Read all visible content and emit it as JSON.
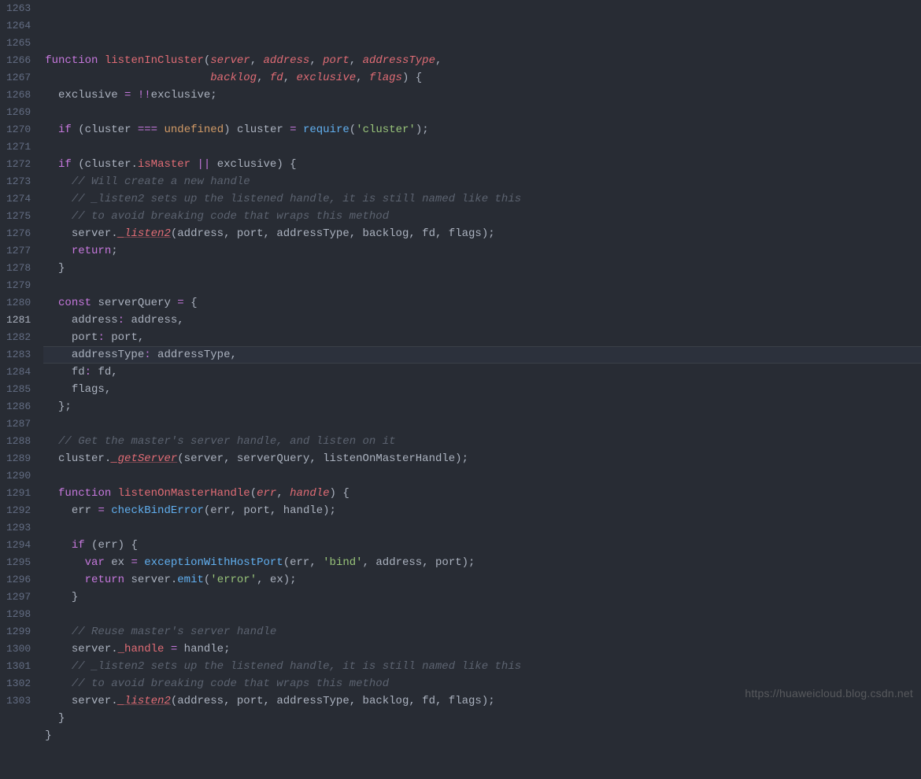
{
  "watermark": "https://huaweicloud.blog.csdn.net",
  "line_start": 1263,
  "line_end": 1303,
  "active_line": 1281,
  "code_lines": {
    "1263": "",
    "1264": "function listenInCluster(server, address, port, addressType,",
    "1265": "                         backlog, fd, exclusive, flags) {",
    "1266": "  exclusive = !!exclusive;",
    "1267": "",
    "1268": "  if (cluster === undefined) cluster = require('cluster');",
    "1269": "",
    "1270": "  if (cluster.isMaster || exclusive) {",
    "1271": "    // Will create a new handle",
    "1272": "    // _listen2 sets up the listened handle, it is still named like this",
    "1273": "    // to avoid breaking code that wraps this method",
    "1274": "    server._listen2(address, port, addressType, backlog, fd, flags);",
    "1275": "    return;",
    "1276": "  }",
    "1277": "",
    "1278": "  const serverQuery = {",
    "1279": "    address: address,",
    "1280": "    port: port,",
    "1281": "    addressType: addressType,",
    "1282": "    fd: fd,",
    "1283": "    flags,",
    "1284": "  };",
    "1285": "",
    "1286": "  // Get the master's server handle, and listen on it",
    "1287": "  cluster._getServer(server, serverQuery, listenOnMasterHandle);",
    "1288": "",
    "1289": "  function listenOnMasterHandle(err, handle) {",
    "1290": "    err = checkBindError(err, port, handle);",
    "1291": "",
    "1292": "    if (err) {",
    "1293": "      var ex = exceptionWithHostPort(err, 'bind', address, port);",
    "1294": "      return server.emit('error', ex);",
    "1295": "    }",
    "1296": "",
    "1297": "    // Reuse master's server handle",
    "1298": "    server._handle = handle;",
    "1299": "    // _listen2 sets up the listened handle, it is still named like this",
    "1300": "    // to avoid breaking code that wraps this method",
    "1301": "    server._listen2(address, port, addressType, backlog, fd, flags);",
    "1302": "  }",
    "1303": "}"
  },
  "tokens": {
    "1264": [
      [
        "kw",
        "function "
      ],
      [
        "decl",
        "listenInCluster"
      ],
      [
        "punc",
        "("
      ],
      [
        "param",
        "server"
      ],
      [
        "punc",
        ", "
      ],
      [
        "param",
        "address"
      ],
      [
        "punc",
        ", "
      ],
      [
        "param",
        "port"
      ],
      [
        "punc",
        ", "
      ],
      [
        "param",
        "addressType"
      ],
      [
        "punc",
        ","
      ]
    ],
    "1265": [
      [
        "ident",
        "                         "
      ],
      [
        "param",
        "backlog"
      ],
      [
        "punc",
        ", "
      ],
      [
        "param",
        "fd"
      ],
      [
        "punc",
        ", "
      ],
      [
        "param",
        "exclusive"
      ],
      [
        "punc",
        ", "
      ],
      [
        "param",
        "flags"
      ],
      [
        "punc",
        ") {"
      ]
    ],
    "1266": [
      [
        "ident",
        "  exclusive "
      ],
      [
        "op",
        "="
      ],
      [
        "ident",
        " "
      ],
      [
        "op",
        "!!"
      ],
      [
        "ident",
        "exclusive"
      ],
      [
        "punc",
        ";"
      ]
    ],
    "1267": [],
    "1268": [
      [
        "ident",
        "  "
      ],
      [
        "kw",
        "if"
      ],
      [
        "punc",
        " ("
      ],
      [
        "ident",
        "cluster "
      ],
      [
        "op",
        "==="
      ],
      [
        "ident",
        " "
      ],
      [
        "const",
        "undefined"
      ],
      [
        "punc",
        ") "
      ],
      [
        "ident",
        "cluster "
      ],
      [
        "op",
        "="
      ],
      [
        "ident",
        " "
      ],
      [
        "fn",
        "require"
      ],
      [
        "punc",
        "("
      ],
      [
        "str",
        "'cluster'"
      ],
      [
        "punc",
        ");"
      ]
    ],
    "1269": [],
    "1270": [
      [
        "ident",
        "  "
      ],
      [
        "kw",
        "if"
      ],
      [
        "punc",
        " ("
      ],
      [
        "ident",
        "cluster"
      ],
      [
        "punc",
        "."
      ],
      [
        "prop",
        "isMaster"
      ],
      [
        "ident",
        " "
      ],
      [
        "op",
        "||"
      ],
      [
        "ident",
        " exclusive"
      ],
      [
        "punc",
        ") {"
      ]
    ],
    "1271": [
      [
        "ident",
        "    "
      ],
      [
        "cm",
        "// Will create a new handle"
      ]
    ],
    "1272": [
      [
        "ident",
        "    "
      ],
      [
        "cm",
        "// _listen2 sets up the listened handle, it is still named like this"
      ]
    ],
    "1273": [
      [
        "ident",
        "    "
      ],
      [
        "cm",
        "// to avoid breaking code that wraps this method"
      ]
    ],
    "1274": [
      [
        "ident",
        "    server"
      ],
      [
        "punc",
        "."
      ],
      [
        "propI",
        "_listen2"
      ],
      [
        "punc",
        "("
      ],
      [
        "ident",
        "address"
      ],
      [
        "punc",
        ", "
      ],
      [
        "ident",
        "port"
      ],
      [
        "punc",
        ", "
      ],
      [
        "ident",
        "addressType"
      ],
      [
        "punc",
        ", "
      ],
      [
        "ident",
        "backlog"
      ],
      [
        "punc",
        ", "
      ],
      [
        "ident",
        "fd"
      ],
      [
        "punc",
        ", "
      ],
      [
        "ident",
        "flags"
      ],
      [
        "punc",
        ");"
      ]
    ],
    "1275": [
      [
        "ident",
        "    "
      ],
      [
        "kw",
        "return"
      ],
      [
        "punc",
        ";"
      ]
    ],
    "1276": [
      [
        "punc",
        "  }"
      ]
    ],
    "1277": [],
    "1278": [
      [
        "ident",
        "  "
      ],
      [
        "kw",
        "const"
      ],
      [
        "ident",
        " serverQuery "
      ],
      [
        "op",
        "="
      ],
      [
        "punc",
        " {"
      ]
    ],
    "1279": [
      [
        "ident",
        "    address"
      ],
      [
        "op",
        ":"
      ],
      [
        "ident",
        " address"
      ],
      [
        "punc",
        ","
      ]
    ],
    "1280": [
      [
        "ident",
        "    port"
      ],
      [
        "op",
        ":"
      ],
      [
        "ident",
        " port"
      ],
      [
        "punc",
        ","
      ]
    ],
    "1281": [
      [
        "ident",
        "    addressType"
      ],
      [
        "op",
        ":"
      ],
      [
        "ident",
        " addressType"
      ],
      [
        "punc",
        ","
      ]
    ],
    "1282": [
      [
        "ident",
        "    fd"
      ],
      [
        "op",
        ":"
      ],
      [
        "ident",
        " fd"
      ],
      [
        "punc",
        ","
      ]
    ],
    "1283": [
      [
        "ident",
        "    flags"
      ],
      [
        "punc",
        ","
      ]
    ],
    "1284": [
      [
        "punc",
        "  };"
      ]
    ],
    "1285": [],
    "1286": [
      [
        "ident",
        "  "
      ],
      [
        "cm",
        "// Get the master's server handle, and listen on it"
      ]
    ],
    "1287": [
      [
        "ident",
        "  cluster"
      ],
      [
        "punc",
        "."
      ],
      [
        "propI",
        "_getServer"
      ],
      [
        "punc",
        "("
      ],
      [
        "ident",
        "server"
      ],
      [
        "punc",
        ", "
      ],
      [
        "ident",
        "serverQuery"
      ],
      [
        "punc",
        ", "
      ],
      [
        "ident",
        "listenOnMasterHandle"
      ],
      [
        "punc",
        ");"
      ]
    ],
    "1288": [],
    "1289": [
      [
        "ident",
        "  "
      ],
      [
        "kw",
        "function "
      ],
      [
        "decl",
        "listenOnMasterHandle"
      ],
      [
        "punc",
        "("
      ],
      [
        "param",
        "err"
      ],
      [
        "punc",
        ", "
      ],
      [
        "param",
        "handle"
      ],
      [
        "punc",
        ") {"
      ]
    ],
    "1290": [
      [
        "ident",
        "    err "
      ],
      [
        "op",
        "="
      ],
      [
        "ident",
        " "
      ],
      [
        "fn",
        "checkBindError"
      ],
      [
        "punc",
        "("
      ],
      [
        "ident",
        "err"
      ],
      [
        "punc",
        ", "
      ],
      [
        "ident",
        "port"
      ],
      [
        "punc",
        ", "
      ],
      [
        "ident",
        "handle"
      ],
      [
        "punc",
        ");"
      ]
    ],
    "1291": [],
    "1292": [
      [
        "ident",
        "    "
      ],
      [
        "kw",
        "if"
      ],
      [
        "punc",
        " ("
      ],
      [
        "ident",
        "err"
      ],
      [
        "punc",
        ") {"
      ]
    ],
    "1293": [
      [
        "ident",
        "      "
      ],
      [
        "kw",
        "var"
      ],
      [
        "ident",
        " ex "
      ],
      [
        "op",
        "="
      ],
      [
        "ident",
        " "
      ],
      [
        "fn",
        "exceptionWithHostPort"
      ],
      [
        "punc",
        "("
      ],
      [
        "ident",
        "err"
      ],
      [
        "punc",
        ", "
      ],
      [
        "str",
        "'bind'"
      ],
      [
        "punc",
        ", "
      ],
      [
        "ident",
        "address"
      ],
      [
        "punc",
        ", "
      ],
      [
        "ident",
        "port"
      ],
      [
        "punc",
        ");"
      ]
    ],
    "1294": [
      [
        "ident",
        "      "
      ],
      [
        "kw",
        "return"
      ],
      [
        "ident",
        " server"
      ],
      [
        "punc",
        "."
      ],
      [
        "fn",
        "emit"
      ],
      [
        "punc",
        "("
      ],
      [
        "str",
        "'error'"
      ],
      [
        "punc",
        ", "
      ],
      [
        "ident",
        "ex"
      ],
      [
        "punc",
        ");"
      ]
    ],
    "1295": [
      [
        "punc",
        "    }"
      ]
    ],
    "1296": [],
    "1297": [
      [
        "ident",
        "    "
      ],
      [
        "cm",
        "// Reuse master's server handle"
      ]
    ],
    "1298": [
      [
        "ident",
        "    server"
      ],
      [
        "punc",
        "."
      ],
      [
        "prop",
        "_handle"
      ],
      [
        "ident",
        " "
      ],
      [
        "op",
        "="
      ],
      [
        "ident",
        " handle"
      ],
      [
        "punc",
        ";"
      ]
    ],
    "1299": [
      [
        "ident",
        "    "
      ],
      [
        "cm",
        "// _listen2 sets up the listened handle, it is still named like this"
      ]
    ],
    "1300": [
      [
        "ident",
        "    "
      ],
      [
        "cm",
        "// to avoid breaking code that wraps this method"
      ]
    ],
    "1301": [
      [
        "ident",
        "    server"
      ],
      [
        "punc",
        "."
      ],
      [
        "propI",
        "_listen2"
      ],
      [
        "punc",
        "("
      ],
      [
        "ident",
        "address"
      ],
      [
        "punc",
        ", "
      ],
      [
        "ident",
        "port"
      ],
      [
        "punc",
        ", "
      ],
      [
        "ident",
        "addressType"
      ],
      [
        "punc",
        ", "
      ],
      [
        "ident",
        "backlog"
      ],
      [
        "punc",
        ", "
      ],
      [
        "ident",
        "fd"
      ],
      [
        "punc",
        ", "
      ],
      [
        "ident",
        "flags"
      ],
      [
        "punc",
        ");"
      ]
    ],
    "1302": [
      [
        "punc",
        "  }"
      ]
    ],
    "1303": [
      [
        "punc",
        "}"
      ]
    ]
  }
}
